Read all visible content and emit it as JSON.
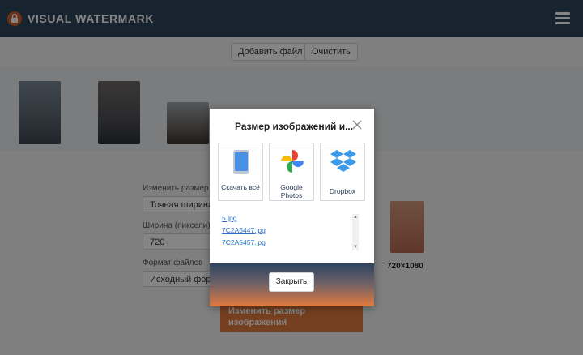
{
  "header": {
    "brand": "VISUAL WATERMARK",
    "logo_icon": "lock-icon",
    "menu_icon": "hamburger-icon"
  },
  "background": {
    "buttons": [
      "Добавить файл",
      "Очистить"
    ],
    "fields": [
      {
        "label": "Изменить размер по",
        "value": "Точная ширина"
      },
      {
        "label": "Ширина (пиксели)",
        "value": "720"
      },
      {
        "label": "Формат файлов",
        "value": "Исходный формат"
      }
    ],
    "apply_button": "Изменить размер изображений",
    "image_dims": "720×1080"
  },
  "modal": {
    "title": "Размер изображений и...",
    "tiles": [
      {
        "label": "Скачать всё",
        "icon": "download-device-icon"
      },
      {
        "label": "Google Photos",
        "icon": "google-photos-icon"
      },
      {
        "label": "Dropbox",
        "icon": "dropbox-icon"
      }
    ],
    "files": [
      "5.jpg",
      "7C2A5447.jpg",
      "7C2A5457.jpg"
    ],
    "close_button": "Закрыть"
  },
  "colors": {
    "header": "#2f435d",
    "accent": "#e27a3f",
    "link": "#2a6fc4"
  }
}
